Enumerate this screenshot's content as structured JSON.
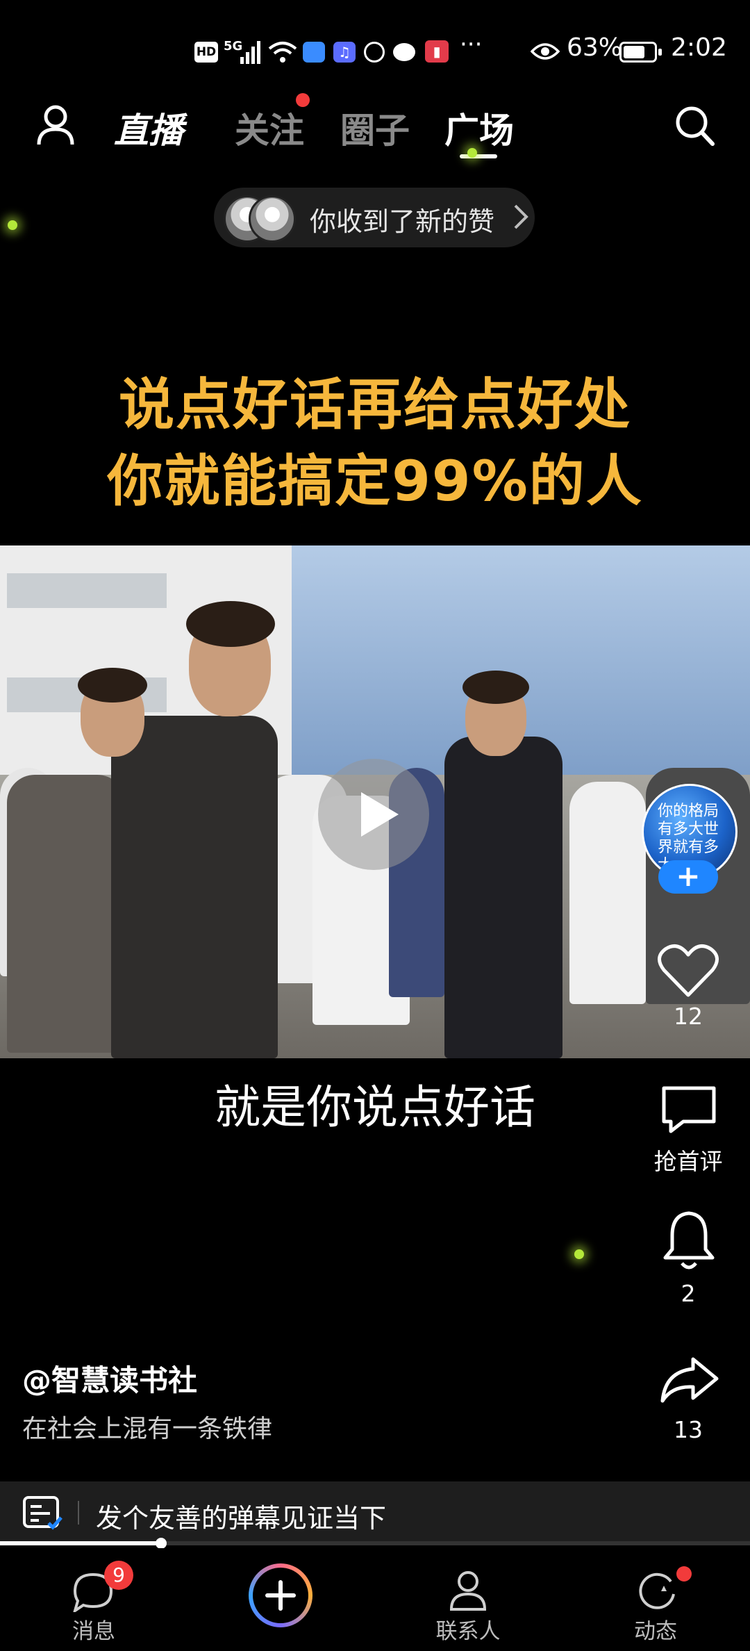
{
  "status_bar": {
    "network_labels": [
      "HD",
      "5G"
    ],
    "battery_percent": "63%",
    "time": "2:02",
    "more": "···"
  },
  "top_nav": {
    "live": "直播",
    "tabs": [
      {
        "label": "关注",
        "has_dot": true
      },
      {
        "label": "圈子",
        "has_dot": false
      },
      {
        "label": "广场",
        "active": true
      }
    ]
  },
  "notification": {
    "text": "你收到了新的赞"
  },
  "video": {
    "headline_line1": "说点好话再给点好处",
    "headline_line2": "你就能搞定99%的人",
    "subtitle": "就是你说点好话",
    "progress": 0.215
  },
  "creator": {
    "avatar_text": "你的格局有多大世界就有多大",
    "follow_symbol": "+"
  },
  "actions": {
    "likes": "12",
    "comment_label": "抢首评",
    "bell_count": "2",
    "shares": "13"
  },
  "post": {
    "author": "@智慧读书社",
    "description": "在社会上混有一条铁律"
  },
  "danmaku": {
    "placeholder": "发个友善的弹幕见证当下"
  },
  "bottom_nav": {
    "messages_label": "消息",
    "messages_badge": "9",
    "contacts_label": "联系人",
    "moments_label": "动态"
  },
  "colors": {
    "headline": "#f6b73c",
    "accent_blue": "#1f86ff",
    "badge_red": "#f23b3b"
  }
}
